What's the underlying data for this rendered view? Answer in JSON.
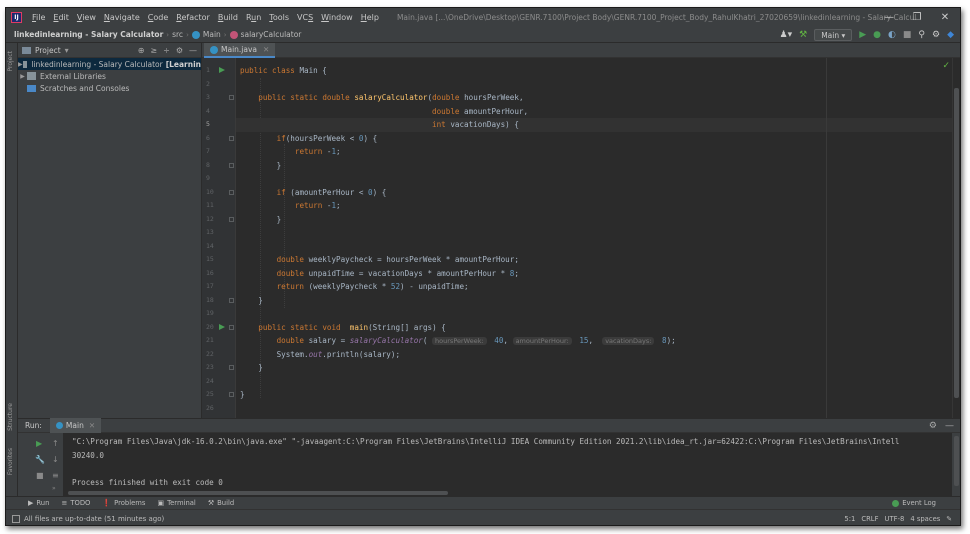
{
  "menubar": {
    "items": [
      {
        "pre": "",
        "u": "F",
        "post": "ile"
      },
      {
        "pre": "",
        "u": "E",
        "post": "dit"
      },
      {
        "pre": "",
        "u": "V",
        "post": "iew"
      },
      {
        "pre": "",
        "u": "N",
        "post": "avigate"
      },
      {
        "pre": "",
        "u": "C",
        "post": "ode"
      },
      {
        "pre": "",
        "u": "R",
        "post": "efactor"
      },
      {
        "pre": "",
        "u": "B",
        "post": "uild"
      },
      {
        "pre": "R",
        "u": "u",
        "post": "n"
      },
      {
        "pre": "",
        "u": "T",
        "post": "ools"
      },
      {
        "pre": "VC",
        "u": "S",
        "post": ""
      },
      {
        "pre": "",
        "u": "W",
        "post": "indow"
      },
      {
        "pre": "",
        "u": "H",
        "post": "elp"
      }
    ],
    "window_title": "Main.java [...\\OneDrive\\Desktop\\GENR.7100\\Project Body\\GENR.7100_Project_Body_RahulKhatri_27020659\\linkedinlearning - Salary Calculator] - Main.java"
  },
  "navbar": {
    "project": "linkedinlearning - Salary Calculator",
    "src": "src",
    "cls": "Main",
    "method": "salaryCalculator",
    "run_config": "Main"
  },
  "project_panel": {
    "title": "Project",
    "tree": [
      {
        "name": "linkedinlearning - Salary Calculator",
        "extra": "[Learnin"
      },
      {
        "name": "External Libraries"
      },
      {
        "name": "Scratches and Consoles"
      }
    ]
  },
  "editor": {
    "tab": "Main.java",
    "line_numbers": [
      "1",
      "2",
      "3",
      "4",
      "5",
      "6",
      "7",
      "8",
      "9",
      "10",
      "11",
      "12",
      "13",
      "14",
      "15",
      "16",
      "17",
      "18",
      "19",
      "20",
      "21",
      "22",
      "23",
      "24",
      "25",
      "26"
    ],
    "current_line": "5",
    "lines": [
      "public class Main {",
      "",
      "    public static double salaryCalculator(double hoursPerWeek,",
      "                                          double amountPerHour,",
      "                                          int vacationDays) {",
      "        if(hoursPerWeek < 0) {",
      "            return -1;",
      "        }",
      "",
      "        if (amountPerHour < 0) {",
      "            return -1;",
      "        }",
      "",
      "",
      "        double weeklyPaycheck = hoursPerWeek * amountPerHour;",
      "        double unpaidTime = vacationDays * amountPerHour * 8;",
      "        return (weeklyPaycheck * 52) - unpaidTime;",
      "    }",
      "",
      "    public static void  main(String[] args) {",
      "        double salary = salaryCalculator( hoursPerWeek: 40, amountPerHour: 15,  vacationDays: 8);",
      "        System.out.println(salary);",
      "    }",
      "",
      "}",
      ""
    ],
    "hints": {
      "h1": "hoursPerWeek:",
      "h2": "amountPerHour:",
      "h3": "vacationDays:"
    }
  },
  "run_panel": {
    "label": "Run:",
    "tab": "Main",
    "console": [
      "\"C:\\Program Files\\Java\\jdk-16.0.2\\bin\\java.exe\" \"-javaagent:C:\\Program Files\\JetBrains\\IntelliJ IDEA Community Edition 2021.2\\lib\\idea_rt.jar=62422:C:\\Program Files\\JetBrains\\Intell",
      "30240.0",
      "",
      "Process finished with exit code 0"
    ]
  },
  "toolwindows": {
    "items": [
      "Run",
      "TODO",
      "Problems",
      "Terminal",
      "Build"
    ],
    "event_log": "Event Log"
  },
  "statusbar": {
    "message": "All files are up-to-date (51 minutes ago)",
    "right": [
      "5:1",
      "CRLF",
      "UTF-8",
      "4 spaces"
    ]
  },
  "side_labels": {
    "project": "Project",
    "structure": "Structure",
    "favorites": "Favorites"
  },
  "colors": {
    "keyword": "#cc7832",
    "number": "#6897bb",
    "method": "#ffc66d",
    "static": "#9876aa",
    "run_green": "#499c54",
    "background": "#2b2b2b"
  }
}
